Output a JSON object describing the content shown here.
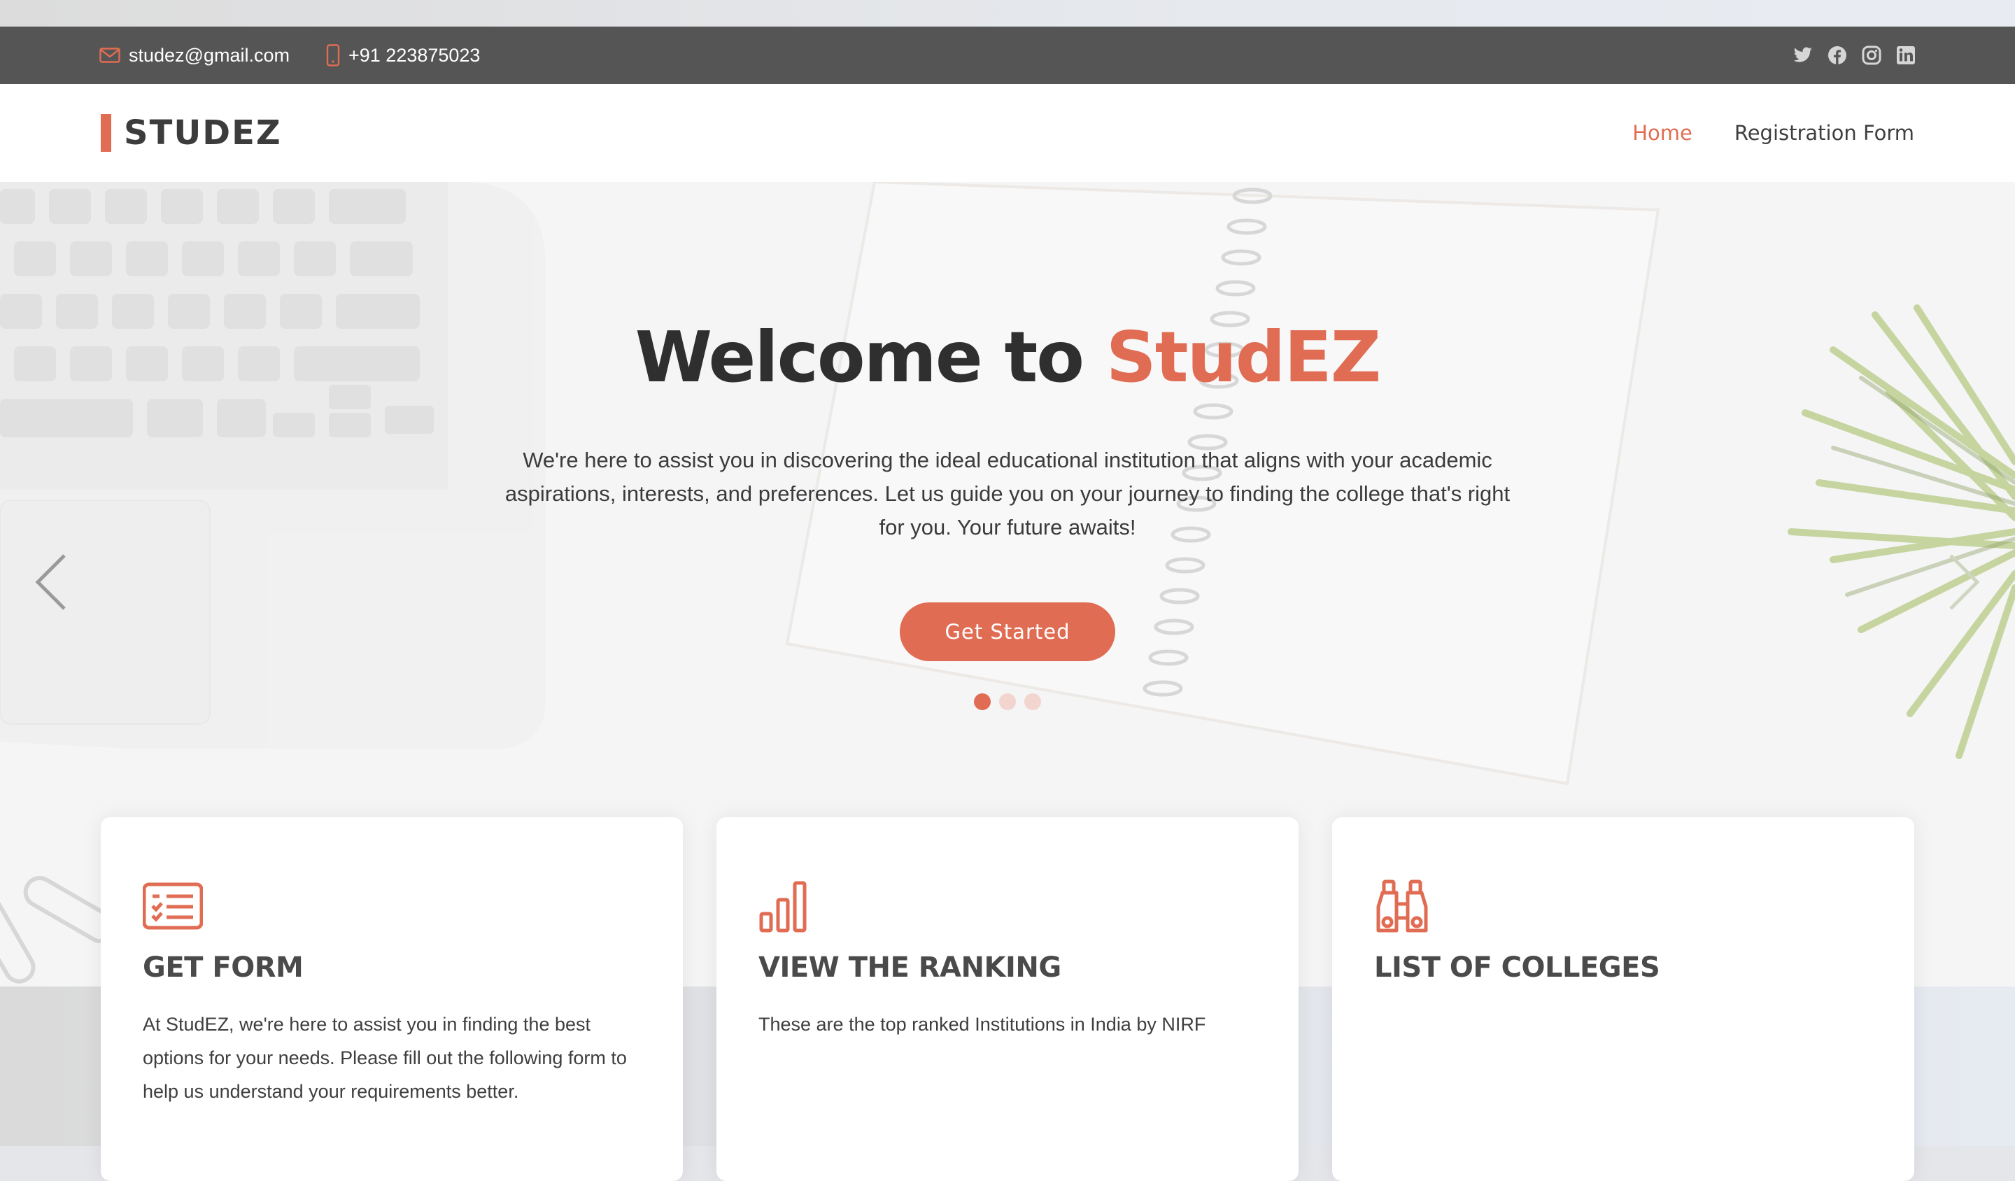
{
  "topbar": {
    "email": "studez@gmail.com",
    "phone": "+91 223875023",
    "social": [
      "twitter-icon",
      "facebook-icon",
      "instagram-icon",
      "linkedin-icon"
    ]
  },
  "brand": {
    "name": "STUDEZ",
    "accent_color": "#e06d53"
  },
  "nav": {
    "items": [
      {
        "label": "Home",
        "active": true
      },
      {
        "label": "Registration Form",
        "active": false
      }
    ]
  },
  "hero": {
    "title_prefix": "Welcome to ",
    "title_accent": "StudEZ",
    "description": "We're here to assist you in discovering the ideal educational institution that aligns with your academic aspirations, interests, and preferences. Let us guide you on your journey to finding the college that's right for you. Your future awaits!",
    "cta_label": "Get Started",
    "slides": 3,
    "active_slide": 1
  },
  "cards": [
    {
      "icon": "form-checklist-icon",
      "title": "GET FORM",
      "description": "At StudEZ, we're here to assist you in finding the best options for your needs. Please fill out the following form to help us understand your requirements better."
    },
    {
      "icon": "bar-chart-icon",
      "title": "VIEW THE RANKING",
      "description": "These are the top ranked Institutions in India by NIRF"
    },
    {
      "icon": "binoculars-icon",
      "title": "LIST OF COLLEGES",
      "description": ""
    }
  ]
}
